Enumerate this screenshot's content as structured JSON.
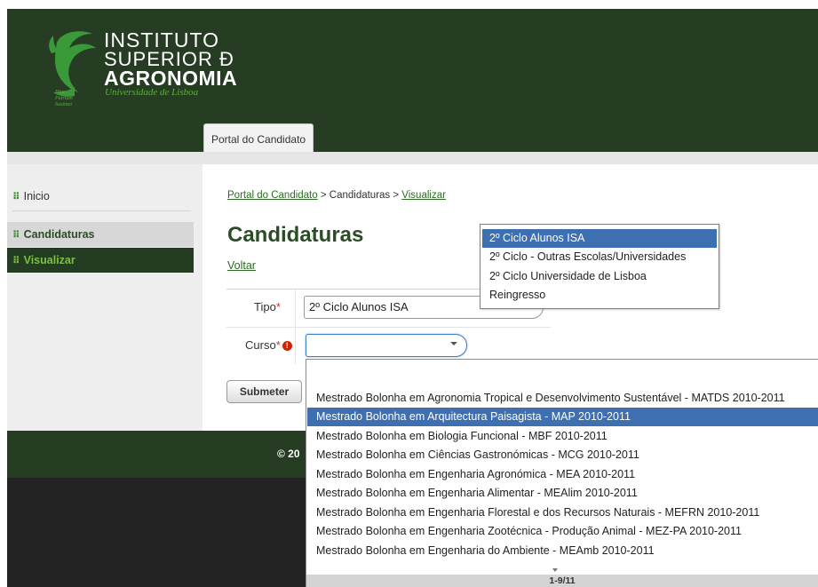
{
  "header": {
    "logo_lines": [
      "INSTITUTO",
      "SUPERIOR Ð",
      "AGRONOMIA"
    ],
    "logo_subtitle": "Universidade de Lisboa",
    "logo_motto": "Hinc Patriam Sustinet",
    "tab_label": "Portal do Candidato"
  },
  "sidebar": {
    "items": [
      {
        "label": "Inicio"
      },
      {
        "label": "Candidaturas"
      },
      {
        "label": "Visualizar"
      }
    ]
  },
  "breadcrumb": {
    "part1": "Portal do Candidato",
    "sep1": " > ",
    "part2": "Candidaturas",
    "sep2": " > ",
    "part3": "Visualizar"
  },
  "main": {
    "title": "Candidaturas",
    "back_link": "Voltar"
  },
  "form": {
    "tipo_label": "Tipo",
    "tipo_value": "2º Ciclo Alunos ISA",
    "curso_label": "Curso",
    "required_mark": "*",
    "warning_icon": "!",
    "curso_value": "",
    "submit_label": "Submeter"
  },
  "tipo_options": [
    {
      "label": "2º Ciclo Alunos ISA",
      "selected": true
    },
    {
      "label": "2º Ciclo - Outras Escolas/Universidades",
      "selected": false
    },
    {
      "label": "2º Ciclo Universidade de Lisboa",
      "selected": false
    },
    {
      "label": "Reingresso",
      "selected": false
    }
  ],
  "curso_options": [
    {
      "label": "Mestrado Bolonha em Agronomia Tropical e Desenvolvimento Sustentável - MATDS 2010-2011",
      "selected": false
    },
    {
      "label": "Mestrado Bolonha em Arquitectura Paisagista - MAP 2010-2011",
      "selected": true
    },
    {
      "label": "Mestrado Bolonha em Biologia Funcional - MBF 2010-2011",
      "selected": false
    },
    {
      "label": "Mestrado Bolonha em Ciências Gastronómicas - MCG 2010-2011",
      "selected": false
    },
    {
      "label": "Mestrado Bolonha em Engenharia Agronómica - MEA 2010-2011",
      "selected": false
    },
    {
      "label": "Mestrado Bolonha em Engenharia Alimentar - MEAlim 2010-2011",
      "selected": false
    },
    {
      "label": "Mestrado Bolonha em Engenharia Florestal e dos Recursos Naturais - MEFRN 2010-2011",
      "selected": false
    },
    {
      "label": "Mestrado Bolonha em Engenharia Zootécnica - Produção Animal - MEZ-PA 2010-2011",
      "selected": false
    },
    {
      "label": "Mestrado Bolonha em Engenharia do Ambiente - MEAmb 2010-2011",
      "selected": false
    }
  ],
  "curso_pager": "1-9/11",
  "footer": {
    "text": "© 20"
  },
  "colors": {
    "header_green": "#263d24",
    "accent_green": "#7bc043",
    "selection_blue": "#3e6fb0",
    "footer_dark": "#222222"
  }
}
